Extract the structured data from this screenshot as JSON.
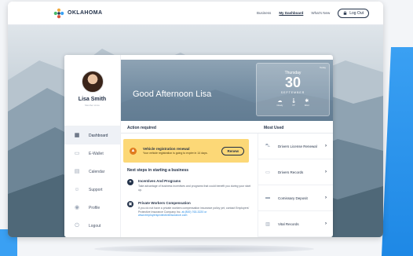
{
  "header": {
    "logo_text": "OKLAHOMA",
    "nav": [
      "Business",
      "My Dashboard",
      "What's New"
    ],
    "logout_label": "Log Out"
  },
  "profile": {
    "name": "Lisa Smith",
    "subtitle": "Member since"
  },
  "sidebar": {
    "items": [
      {
        "label": "Dashboard",
        "icon": "grid-icon",
        "active": true
      },
      {
        "label": "E-Wallet",
        "icon": "wallet-icon",
        "active": false
      },
      {
        "label": "Calendar",
        "icon": "calendar-icon",
        "active": false
      },
      {
        "label": "Support",
        "icon": "support-icon",
        "active": false
      },
      {
        "label": "Profile",
        "icon": "person-icon",
        "active": false
      },
      {
        "label": "Logout",
        "icon": "power-icon",
        "active": false
      }
    ]
  },
  "greeting": "Good Afternoon Lisa",
  "weather": {
    "today_label": "Today",
    "day": "Thursday",
    "date": "30",
    "month": "SEPTEMBER",
    "items": [
      {
        "icon": "cloud-icon",
        "label": "Cloudy"
      },
      {
        "icon": "thermometer-icon",
        "label": "72°"
      },
      {
        "icon": "wind-icon",
        "label": "Wind"
      }
    ]
  },
  "action_required": {
    "title": "Action required",
    "alert_title": "Vehicle registration renewal",
    "alert_text": "Your vehicle registration is going to expire in 14 days.",
    "renew_label": "Renew"
  },
  "next_steps": {
    "title": "Next steps in starting a business",
    "items": [
      {
        "title": "Incentives And Programs",
        "text": "Take advantage of business incentives and programs that could benefit you during your start up."
      },
      {
        "title": "Private Workers Compensation",
        "text": "If you do not have a private workers compensation insurance policy yet, contact Employers' Protective Insurance Company Inc.",
        "link": "at (800) 763-3220 or www.employersprotectiveinsurance.com"
      }
    ]
  },
  "most_used": {
    "title": "Most Used",
    "items": [
      {
        "label": "Drivers License Renewal",
        "icon": "car-icon"
      },
      {
        "label": "Drivers Records",
        "icon": "folder-icon"
      },
      {
        "label": "Comissary Deposit",
        "icon": "deposit-icon"
      },
      {
        "label": "Vital Records",
        "icon": "document-icon"
      }
    ]
  },
  "colors": {
    "accent": "#1e88e5",
    "alert_bg": "#fcd877",
    "alert_icon": "#e07b1f",
    "navy": "#1f2d44"
  }
}
